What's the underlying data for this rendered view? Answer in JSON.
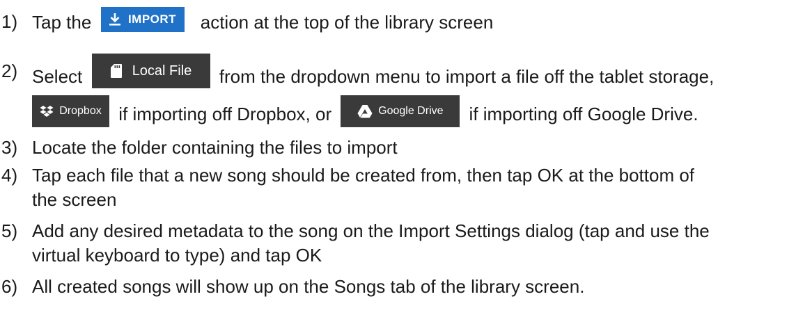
{
  "steps": [
    {
      "number": "1)",
      "before": "Tap the",
      "chip_label": "IMPORT",
      "chip_icon": "download-icon",
      "after": "action at the top of the library screen"
    },
    {
      "number": "2)",
      "before": "Select",
      "chip_label": "Local File",
      "chip_icon": "sd-card-icon",
      "after": "from the dropdown menu to import a file off the tablet storage,",
      "line2": {
        "dropbox_label": "Dropbox",
        "dropbox_icon": "dropbox-icon",
        "middle": "if importing off Dropbox, or",
        "gdrive_label": "Google Drive",
        "gdrive_icon": "google-drive-icon",
        "end": "if importing off Google Drive."
      }
    },
    {
      "number": "3)",
      "text": "Locate the folder containing the files to import"
    },
    {
      "number": "4)",
      "text": "Tap each file that a new song should be created from, then tap OK at the bottom of",
      "text2": "the screen"
    },
    {
      "number": "5)",
      "text": "Add any desired metadata to the song on the Import Settings dialog (tap and use the",
      "text2": "virtual keyboard to type) and tap OK"
    },
    {
      "number": "6)",
      "text": "All created songs will show up on the Songs tab of the library screen."
    }
  ],
  "colors": {
    "import_chip": "#1f72c8",
    "dark_chip": "#3a3a3a",
    "text": "#1a1a1a"
  }
}
